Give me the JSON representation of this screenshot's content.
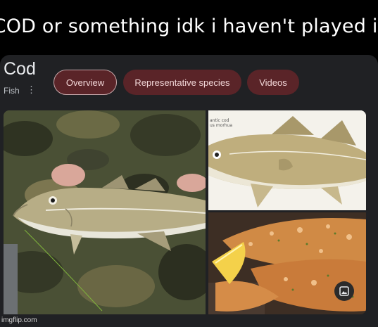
{
  "meme_caption": "COD or something idk i haven't played it",
  "knowledge_panel": {
    "title": "Cod",
    "subtitle": "Fish",
    "chips": [
      {
        "label": "Overview",
        "selected": true
      },
      {
        "label": "Representative species",
        "selected": false
      },
      {
        "label": "Videos",
        "selected": false
      }
    ],
    "images": {
      "main": "person holding a caught cod",
      "top_right_label_line1": "antic cod",
      "top_right_label_line2": "us morhua",
      "bottom_right": "baked seasoned cod fillets with lemon"
    },
    "gallery_icon": "image-icon"
  },
  "colors": {
    "chip_bg": "#5a2428",
    "chip_text": "#f2d7d8",
    "panel_bg": "#202124"
  },
  "watermark": "imgflip.com"
}
